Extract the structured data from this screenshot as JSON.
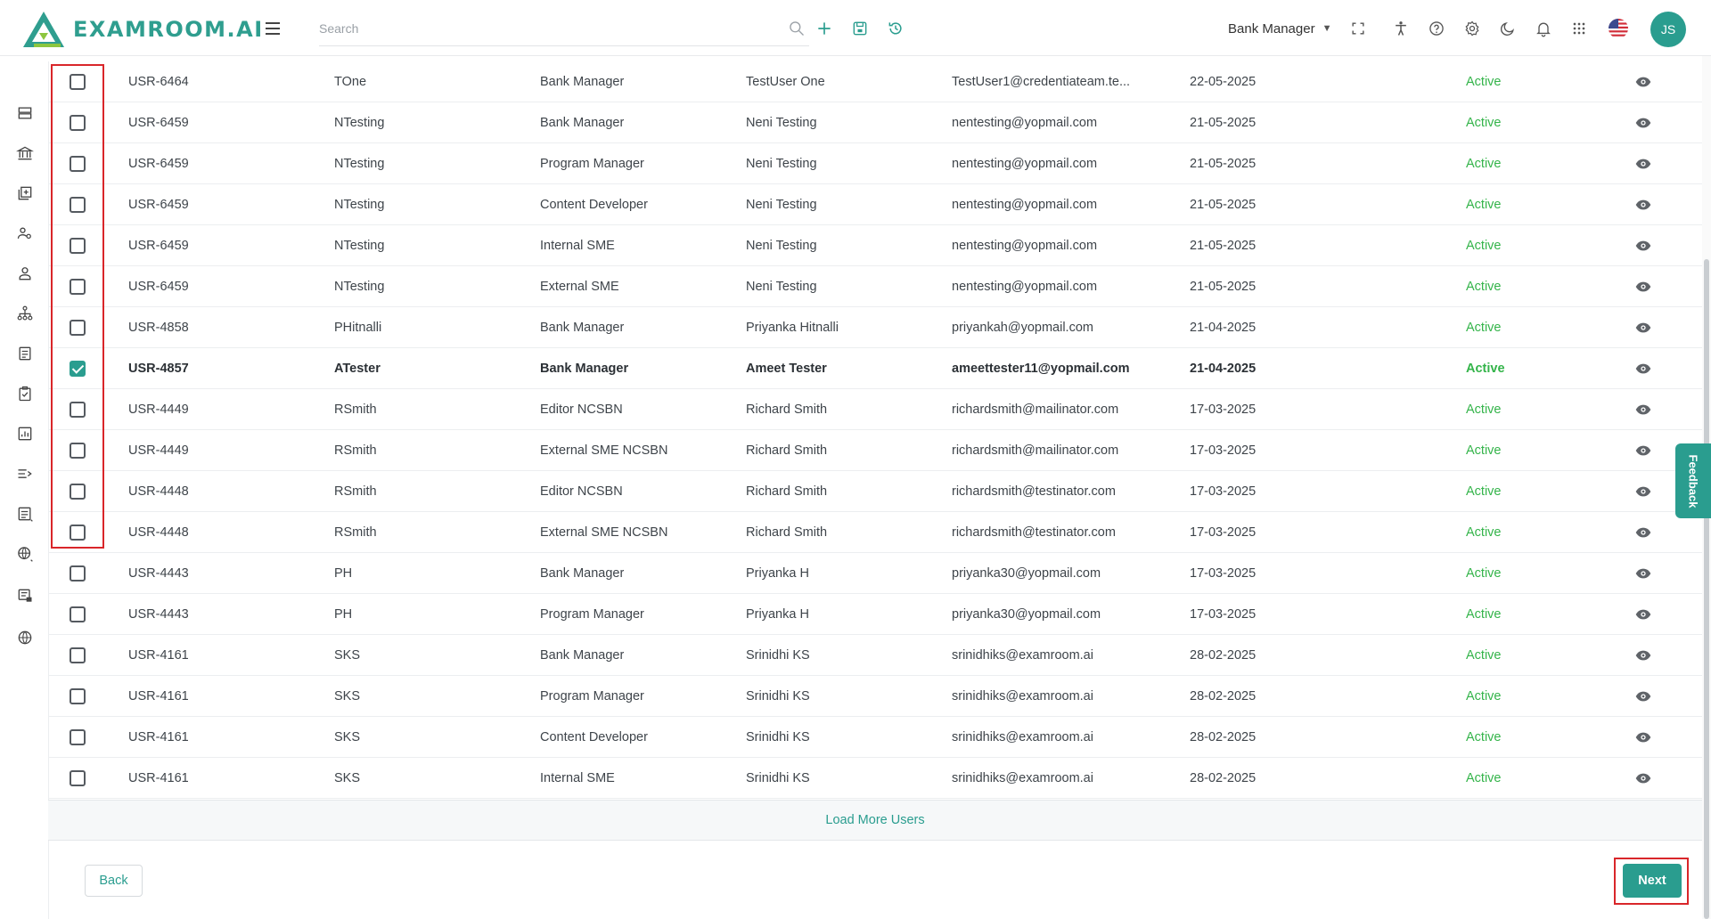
{
  "app": {
    "logo_text": "EXAMROOM.AI"
  },
  "topbar": {
    "search_placeholder": "Search",
    "role": "Bank Manager",
    "avatar_initials": "JS",
    "icons": [
      "search-icon",
      "add-icon",
      "save-icon",
      "history-icon",
      "fullscreen-icon",
      "accessibility-icon",
      "help-icon",
      "settings-icon",
      "dark-mode-icon",
      "notifications-icon",
      "apps-grid-icon",
      "us-flag-icon"
    ]
  },
  "sidebar": {
    "icons": [
      "storage-icon",
      "bank-icon",
      "add-library-icon",
      "user-roles-icon",
      "user-icon",
      "hierarchy-icon",
      "document-icon",
      "clipboard-check-icon",
      "report-chart-icon",
      "list-filter-icon",
      "list-details-icon",
      "globe-settings-icon",
      "publish-icon",
      "globe-icon"
    ]
  },
  "rows": [
    {
      "id": "USR-6464",
      "username": "TOne",
      "role": "Bank Manager",
      "name": "TestUser One",
      "email": "TestUser1@credentiateam.te...",
      "date": "22-05-2025",
      "status": "Active",
      "checked": false
    },
    {
      "id": "USR-6459",
      "username": "NTesting",
      "role": "Bank Manager",
      "name": "Neni Testing",
      "email": "nentesting@yopmail.com",
      "date": "21-05-2025",
      "status": "Active",
      "checked": false
    },
    {
      "id": "USR-6459",
      "username": "NTesting",
      "role": "Program Manager",
      "name": "Neni Testing",
      "email": "nentesting@yopmail.com",
      "date": "21-05-2025",
      "status": "Active",
      "checked": false
    },
    {
      "id": "USR-6459",
      "username": "NTesting",
      "role": "Content Developer",
      "name": "Neni Testing",
      "email": "nentesting@yopmail.com",
      "date": "21-05-2025",
      "status": "Active",
      "checked": false
    },
    {
      "id": "USR-6459",
      "username": "NTesting",
      "role": "Internal SME",
      "name": "Neni Testing",
      "email": "nentesting@yopmail.com",
      "date": "21-05-2025",
      "status": "Active",
      "checked": false
    },
    {
      "id": "USR-6459",
      "username": "NTesting",
      "role": "External SME",
      "name": "Neni Testing",
      "email": "nentesting@yopmail.com",
      "date": "21-05-2025",
      "status": "Active",
      "checked": false
    },
    {
      "id": "USR-4858",
      "username": "PHitnalli",
      "role": "Bank Manager",
      "name": "Priyanka Hitnalli",
      "email": "priyankah@yopmail.com",
      "date": "21-04-2025",
      "status": "Active",
      "checked": false
    },
    {
      "id": "USR-4857",
      "username": "ATester",
      "role": "Bank Manager",
      "name": "Ameet Tester",
      "email": "ameettester11@yopmail.com",
      "date": "21-04-2025",
      "status": "Active",
      "checked": true
    },
    {
      "id": "USR-4449",
      "username": "RSmith",
      "role": "Editor NCSBN",
      "name": "Richard Smith",
      "email": "richardsmith@mailinator.com",
      "date": "17-03-2025",
      "status": "Active",
      "checked": false
    },
    {
      "id": "USR-4449",
      "username": "RSmith",
      "role": "External SME NCSBN",
      "name": "Richard Smith",
      "email": "richardsmith@mailinator.com",
      "date": "17-03-2025",
      "status": "Active",
      "checked": false
    },
    {
      "id": "USR-4448",
      "username": "RSmith",
      "role": "Editor NCSBN",
      "name": "Richard Smith",
      "email": "richardsmith@testinator.com",
      "date": "17-03-2025",
      "status": "Active",
      "checked": false
    },
    {
      "id": "USR-4448",
      "username": "RSmith",
      "role": "External SME NCSBN",
      "name": "Richard Smith",
      "email": "richardsmith@testinator.com",
      "date": "17-03-2025",
      "status": "Active",
      "checked": false
    },
    {
      "id": "USR-4443",
      "username": "PH",
      "role": "Bank Manager",
      "name": "Priyanka H",
      "email": "priyanka30@yopmail.com",
      "date": "17-03-2025",
      "status": "Active",
      "checked": false
    },
    {
      "id": "USR-4443",
      "username": "PH",
      "role": "Program Manager",
      "name": "Priyanka H",
      "email": "priyanka30@yopmail.com",
      "date": "17-03-2025",
      "status": "Active",
      "checked": false
    },
    {
      "id": "USR-4161",
      "username": "SKS",
      "role": "Bank Manager",
      "name": "Srinidhi KS",
      "email": "srinidhiks@examroom.ai",
      "date": "28-02-2025",
      "status": "Active",
      "checked": false
    },
    {
      "id": "USR-4161",
      "username": "SKS",
      "role": "Program Manager",
      "name": "Srinidhi KS",
      "email": "srinidhiks@examroom.ai",
      "date": "28-02-2025",
      "status": "Active",
      "checked": false
    },
    {
      "id": "USR-4161",
      "username": "SKS",
      "role": "Content Developer",
      "name": "Srinidhi KS",
      "email": "srinidhiks@examroom.ai",
      "date": "28-02-2025",
      "status": "Active",
      "checked": false
    },
    {
      "id": "USR-4161",
      "username": "SKS",
      "role": "Internal SME",
      "name": "Srinidhi KS",
      "email": "srinidhiks@examroom.ai",
      "date": "28-02-2025",
      "status": "Active",
      "checked": false
    }
  ],
  "table": {
    "load_more_label": "Load More Users"
  },
  "footer": {
    "back_label": "Back",
    "next_label": "Next"
  },
  "feedback_label": "Feedback",
  "colors": {
    "accent": "#2a9d8f",
    "status_active": "#34b44a",
    "highlight": "#d9262a"
  }
}
